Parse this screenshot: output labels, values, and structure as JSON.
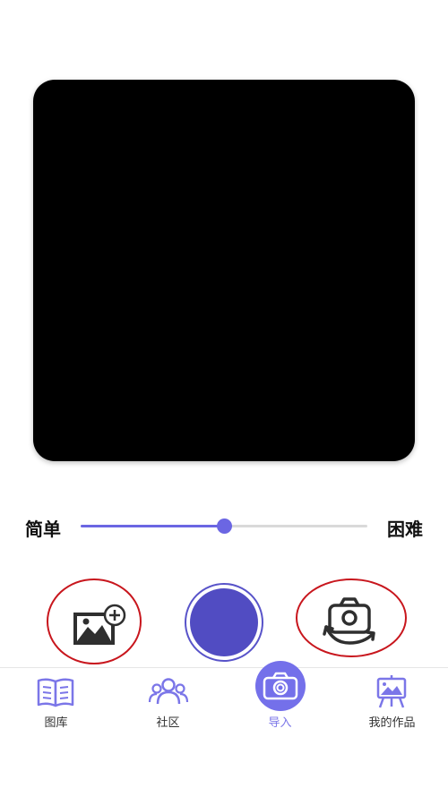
{
  "camera": {
    "viewfinder": "camera-preview"
  },
  "difficulty": {
    "easy_label": "简单",
    "hard_label": "困难",
    "value_fraction": 0.5,
    "accent_color": "#6b66e3"
  },
  "actions": {
    "gallery_icon": "image-add-icon",
    "shutter_icon": "shutter-button",
    "switch_icon": "switch-camera-icon"
  },
  "tabs": [
    {
      "label": "图库",
      "icon": "book-icon",
      "active": false
    },
    {
      "label": "社区",
      "icon": "community-icon",
      "active": false
    },
    {
      "label": "导入",
      "icon": "camera-icon",
      "active": true
    },
    {
      "label": "我的作品",
      "icon": "easel-icon",
      "active": false
    }
  ]
}
